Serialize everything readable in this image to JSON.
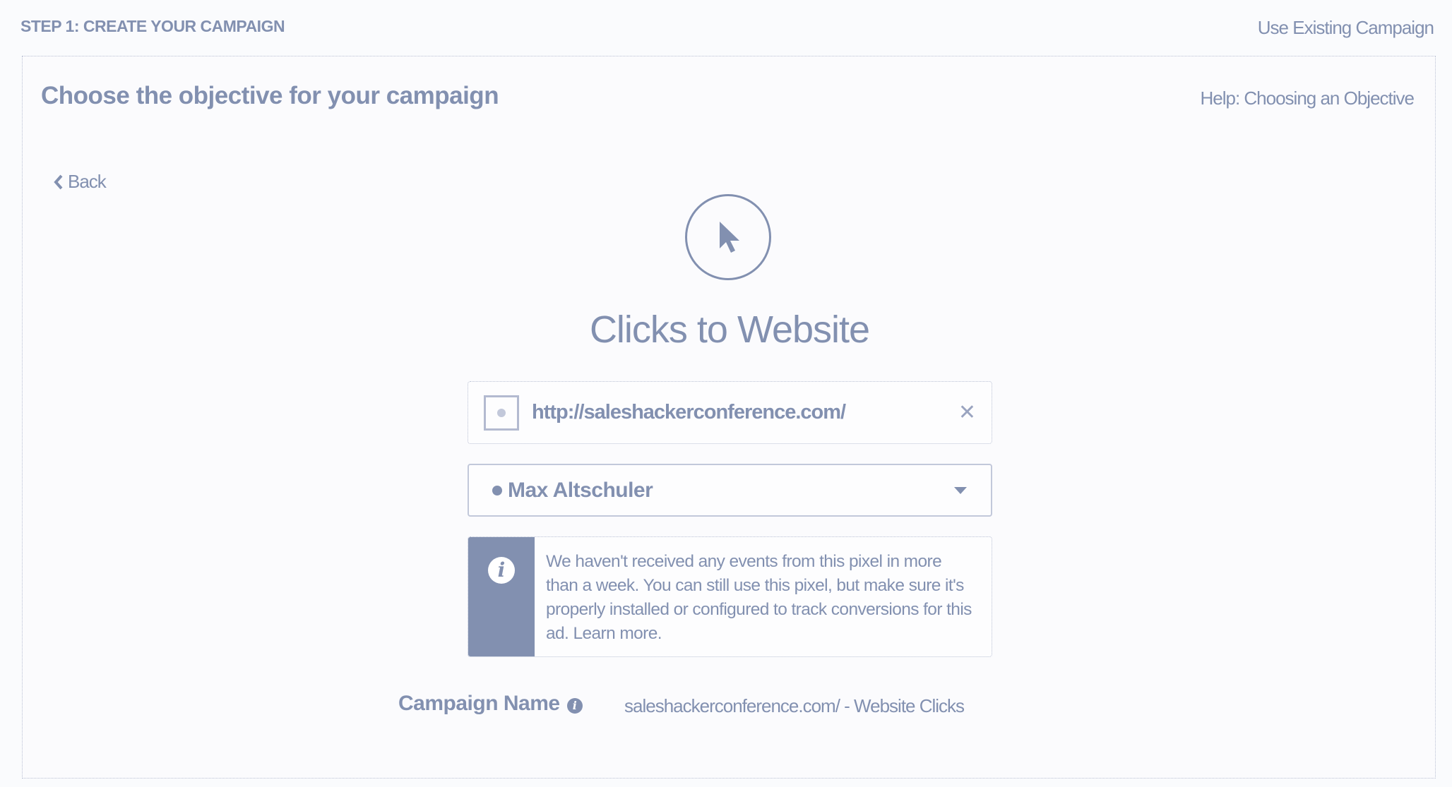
{
  "header": {
    "step_label": "STEP 1: CREATE YOUR CAMPAIGN",
    "use_existing_label": "Use Existing Campaign"
  },
  "panel": {
    "heading": "Choose the objective for your campaign",
    "help_link": "Help: Choosing an Objective",
    "back_label": "Back",
    "objective_icon": "cursor-arrow-icon",
    "objective_title": "Clicks to Website",
    "url_field": {
      "value": "http://saleshackerconference.com/",
      "clear_icon": "✕"
    },
    "pixel_select": {
      "selected": "Max Altschuler"
    },
    "info_message": {
      "icon": "i",
      "text": "We haven't received any events from this pixel in more than a week. You can still use this pixel, but make sure it's properly installed or configured to track conversions for this ad. Learn more."
    },
    "campaign_name": {
      "label": "Campaign Name",
      "info_icon": "i",
      "value": "saleshackerconference.com/ - Website Clicks"
    }
  },
  "colors": {
    "accent": "#8290b0",
    "background": "#fafbfd",
    "border": "#b9c0d4"
  }
}
